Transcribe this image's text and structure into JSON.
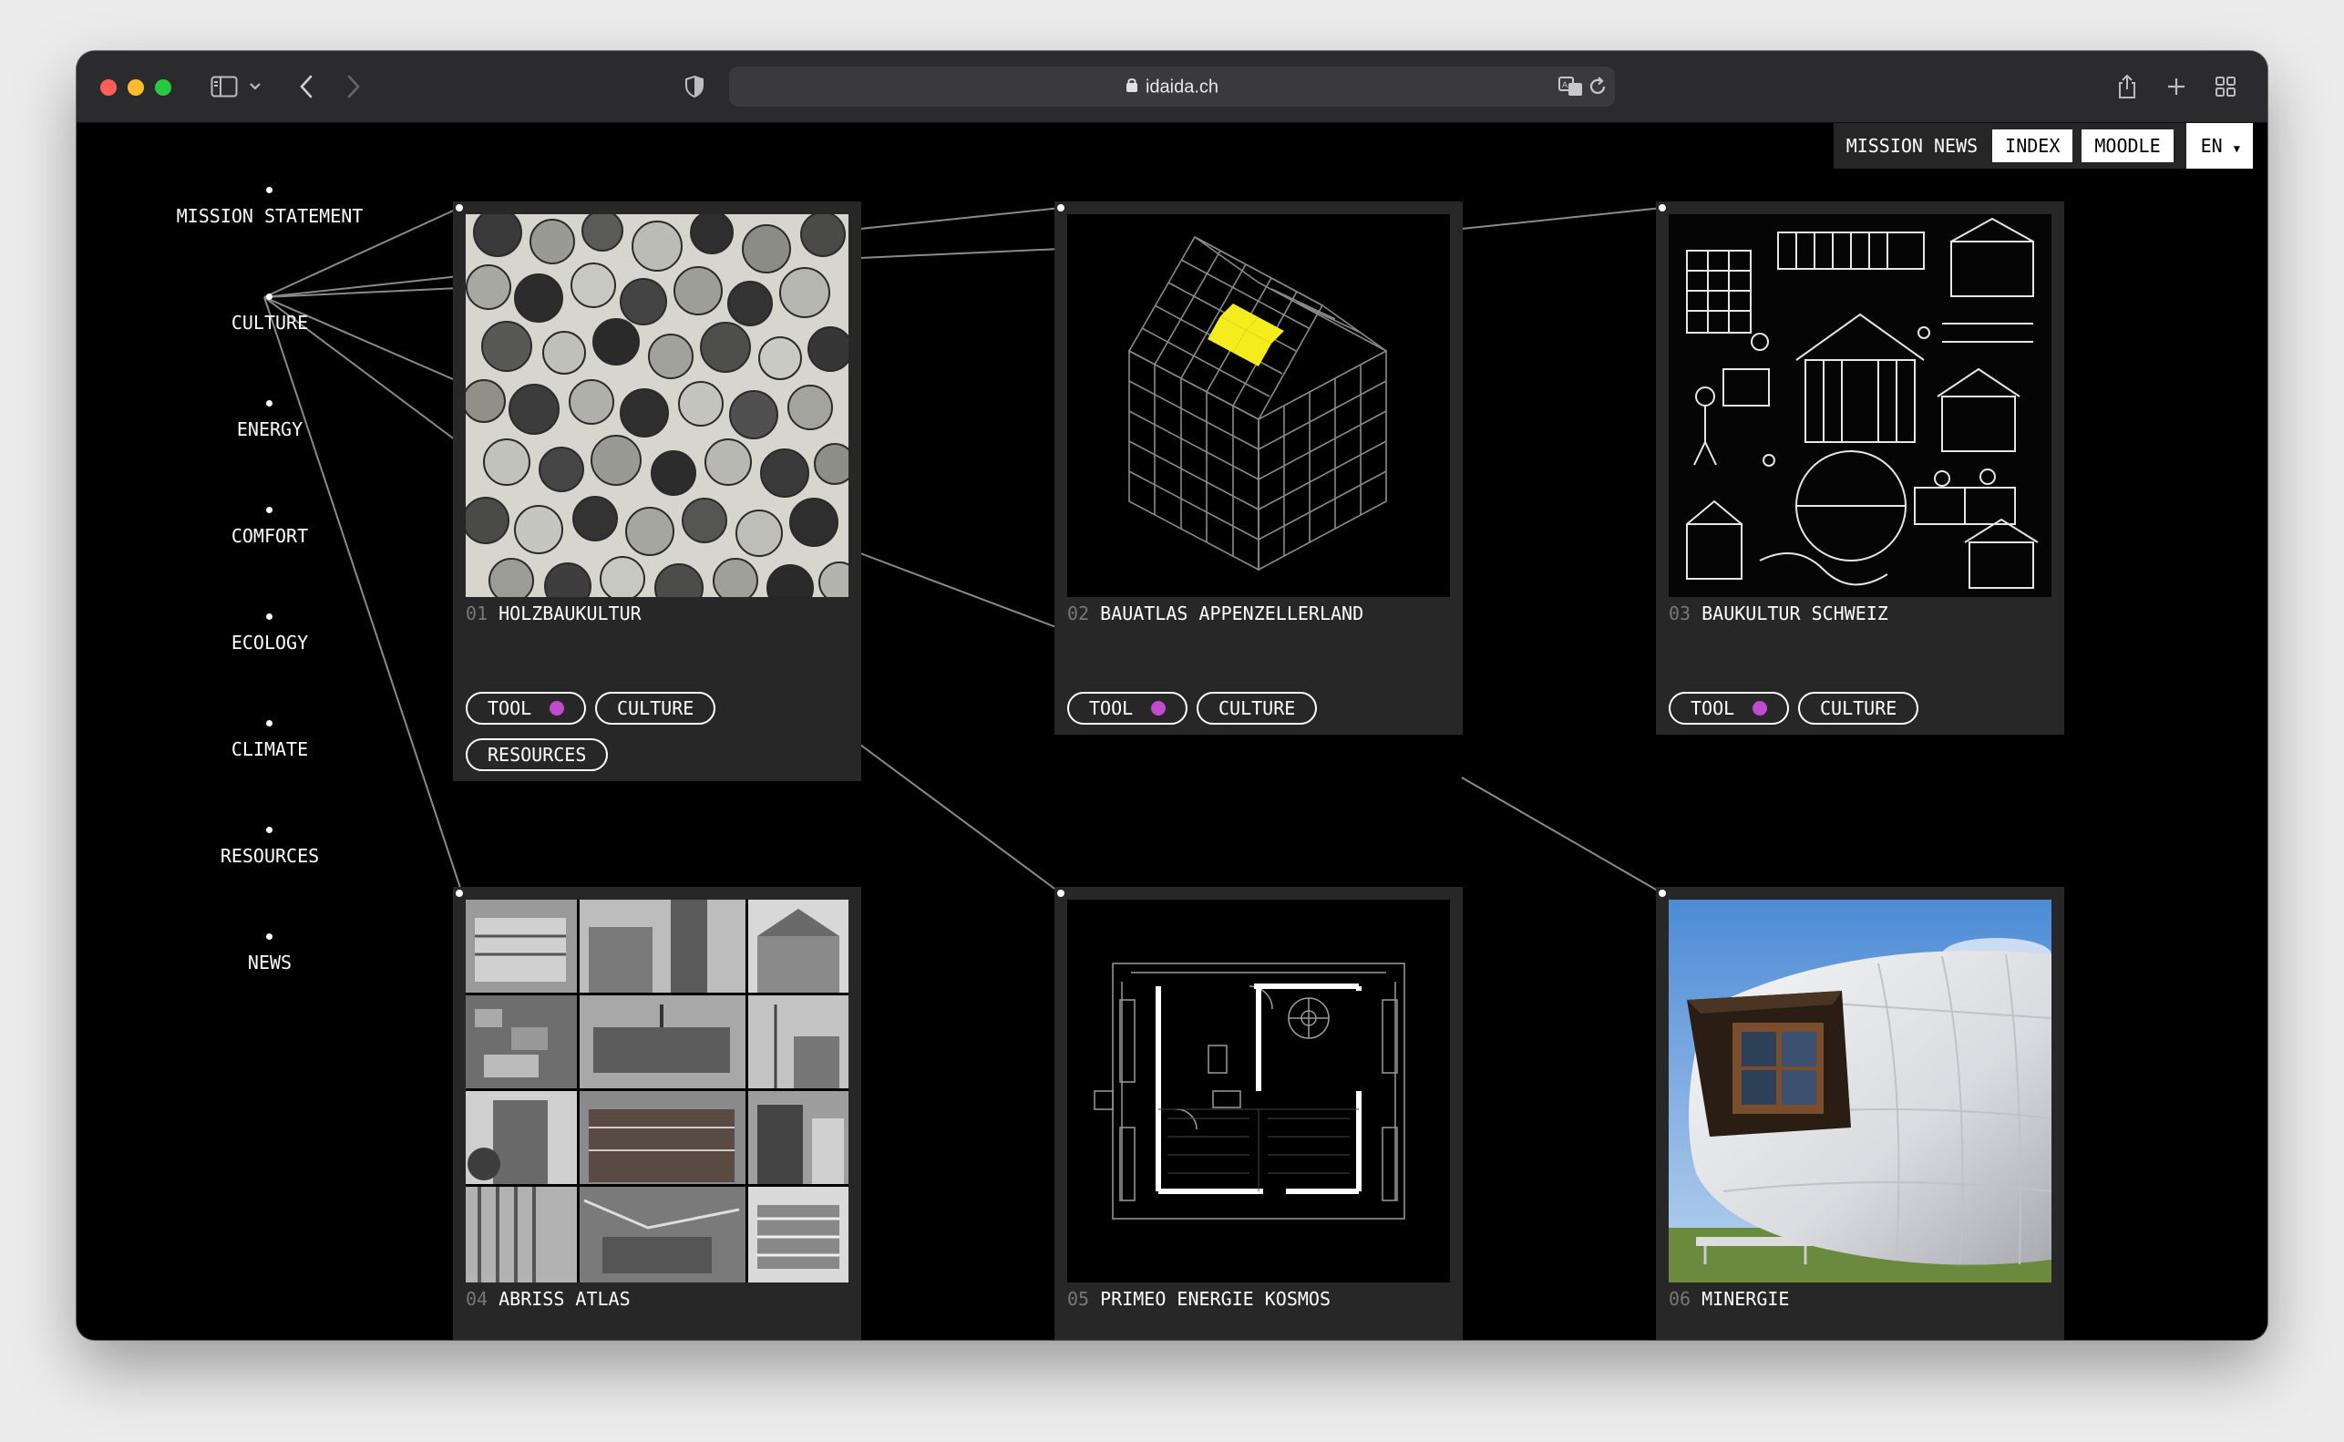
{
  "browser": {
    "url": "idaida.ch"
  },
  "topnav": {
    "mission": "MISSION",
    "news": "NEWS",
    "index": "INDEX",
    "moodle": "MOODLE",
    "lang": "EN"
  },
  "sidebar": {
    "items": [
      {
        "label": "MISSION STATEMENT"
      },
      {
        "label": "CULTURE"
      },
      {
        "label": "ENERGY"
      },
      {
        "label": "COMFORT"
      },
      {
        "label": "ECOLOGY"
      },
      {
        "label": "CLIMATE"
      },
      {
        "label": "RESOURCES"
      },
      {
        "label": "NEWS"
      }
    ]
  },
  "cards": [
    {
      "num": "01",
      "title": "HOLZBAUKULTUR",
      "tags": [
        "TOOL",
        "CULTURE",
        "RESOURCES"
      ]
    },
    {
      "num": "02",
      "title": "BAUATLAS APPENZELLERLAND",
      "tags": [
        "TOOL",
        "CULTURE"
      ]
    },
    {
      "num": "03",
      "title": "BAUKULTUR SCHWEIZ",
      "tags": [
        "TOOL",
        "CULTURE"
      ]
    },
    {
      "num": "04",
      "title": "ABRISS ATLAS",
      "tags": []
    },
    {
      "num": "05",
      "title": "PRIMEO ENERGIE KOSMOS",
      "tags": []
    },
    {
      "num": "06",
      "title": "MINERGIE",
      "tags": []
    }
  ],
  "colors": {
    "tool_dot": "#c04bd0",
    "highlight": "#f5ec1e",
    "card_bg": "#272727"
  }
}
